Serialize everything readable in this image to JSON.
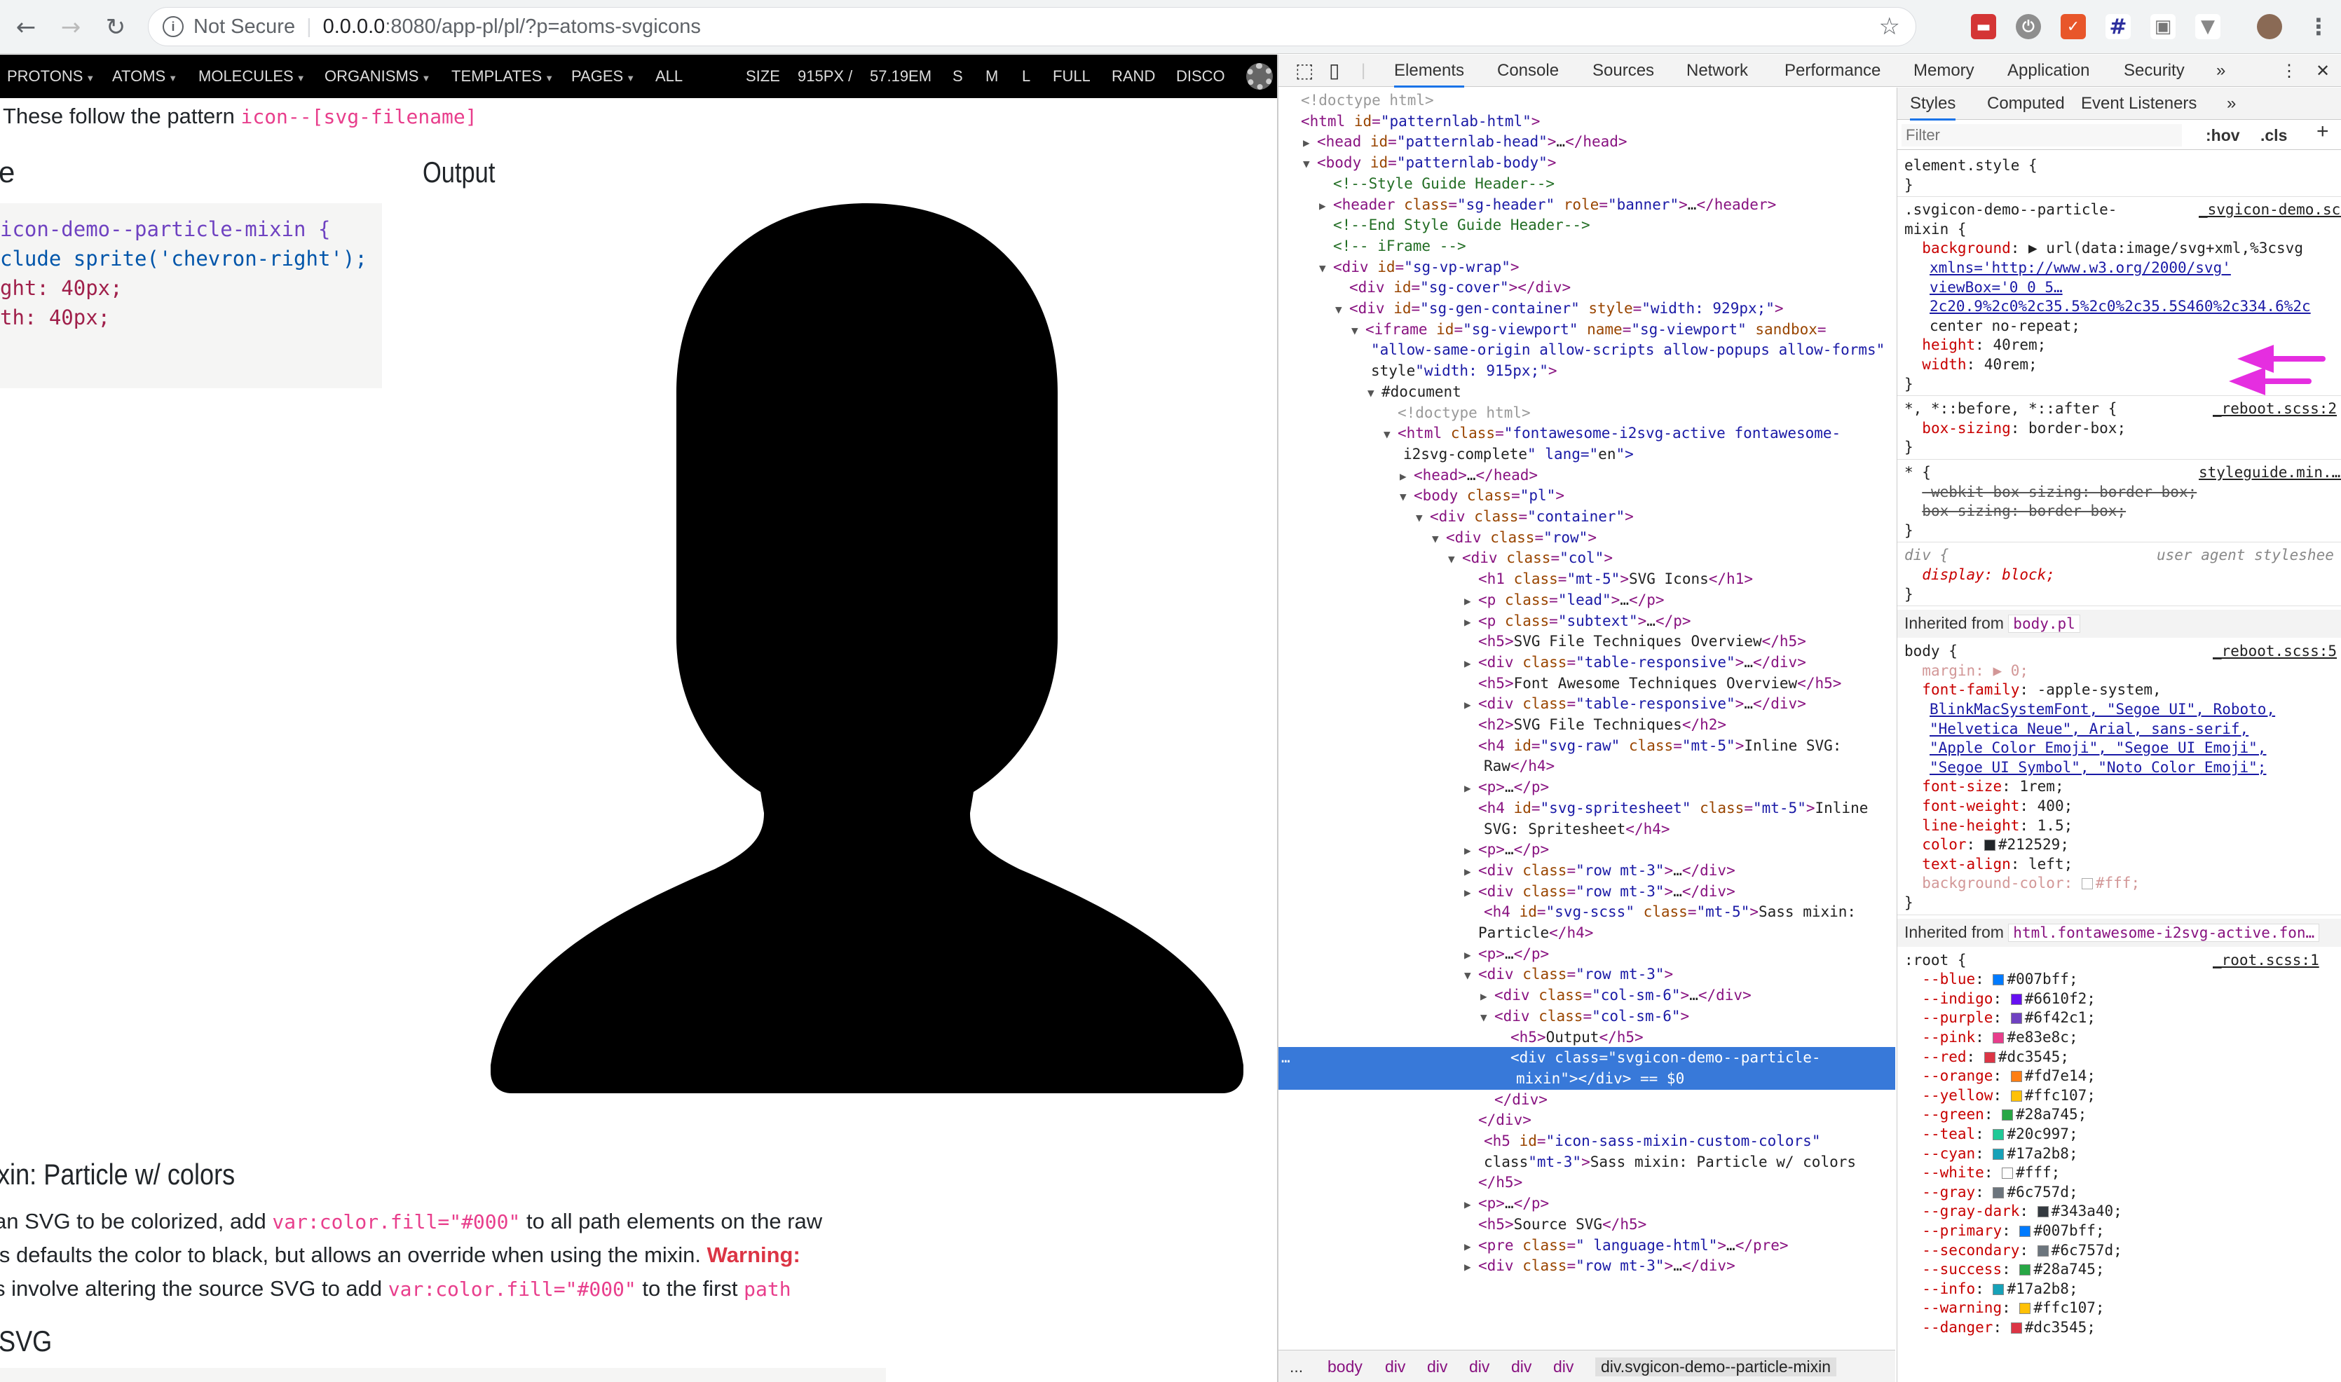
{
  "browser": {
    "security_label": "Not Secure",
    "url_host": "0.0.0.0",
    "url_path": ":8080/app-pl/pl/?p=atoms-svgicons"
  },
  "pl_nav": {
    "items": [
      {
        "label": "PROTONS"
      },
      {
        "label": "ATOMS"
      },
      {
        "label": "MOLECULES"
      },
      {
        "label": "ORGANISMS"
      },
      {
        "label": "TEMPLATES"
      },
      {
        "label": "PAGES"
      }
    ],
    "all_label": "ALL",
    "size_label": "SIZE",
    "size_px": "915PX /",
    "size_em": "57.19EM",
    "s": "S",
    "m": "M",
    "l": "L",
    "full": "FULL",
    "rand": "RAND",
    "disco": "DISCO"
  },
  "page": {
    "pattern_text": "These follow the pattern ",
    "pattern_code": "icon--[svg-filename]",
    "left_heading": "e",
    "output_heading": "Output",
    "code_lines": [
      "icon-demo--particle-mixin {",
      "clude sprite('chevron-right');",
      "ght: 40px;",
      "th: 40px;"
    ],
    "section_heading": "xin: Particle w/ colors",
    "p1a": " an SVG to be colorized, add ",
    "p1code": "var:color.fill=\"#000\"",
    "p1b": " to all path elements on the raw",
    "p2a": "is defaults the color to black, but allows an override when using the mixin. ",
    "p2warn": "Warning:",
    "p3a": "s involve altering the source SVG to add ",
    "p3code": "var:color.fill=\"#000\"",
    "p3b": " to the first ",
    "p3code2": "path",
    "p4": ".",
    "svg_heading": "SVG"
  },
  "devtools": {
    "tabs": [
      "Elements",
      "Console",
      "Sources",
      "Network",
      "Performance",
      "Memory",
      "Application",
      "Security"
    ],
    "more": "»",
    "breadcrumbs": [
      "...",
      "body",
      "div",
      "div",
      "div",
      "div",
      "div",
      "div.svgicon-demo--particle-mixin"
    ],
    "styles_tabs": [
      "Styles",
      "Computed",
      "Event Listeners",
      "»"
    ],
    "filter_placeholder": "Filter",
    "hov": ":hov",
    "cls": ".cls",
    "plus": "+",
    "inherited_body_label": "Inherited from ",
    "inherited_body_tag": "body.pl",
    "inherited_html_label": "Inherited from ",
    "inherited_html_tag": "html.fontawesome-i2svg-active.fon…"
  },
  "dom": [
    {
      "i": 0,
      "h": "<!doctype html>"
    },
    {
      "i": 0,
      "h": "<html id=\"patternlab-html\">"
    },
    {
      "i": 1,
      "h": "▶<head id=\"patternlab-head\">…</head>"
    },
    {
      "i": 1,
      "h": "▼<body id=\"patternlab-body\">"
    },
    {
      "i": 2,
      "h": "<!--Style Guide Header-->"
    },
    {
      "i": 2,
      "h": "▶<header class=\"sg-header\" role=\"banner\">…</header>"
    },
    {
      "i": 2,
      "h": "<!--End Style Guide Header-->"
    },
    {
      "i": 2,
      "h": "<!-- iFrame -->"
    },
    {
      "i": 2,
      "h": "▼<div id=\"sg-vp-wrap\">"
    },
    {
      "i": 3,
      "h": "<div id=\"sg-cover\"></div>"
    },
    {
      "i": 3,
      "h": "▼<div id=\"sg-gen-container\" style=\"width: 929px;\">"
    },
    {
      "i": 4,
      "h": "▼<iframe id=\"sg-viewport\" name=\"sg-viewport\" sandbox="
    },
    {
      "i": 4,
      "h": "\"allow-same-origin allow-scripts allow-popups allow-forms\""
    },
    {
      "i": 4,
      "h": "style=\"width: 915px;\">"
    },
    {
      "i": 5,
      "h": "▼#document"
    },
    {
      "i": 6,
      "h": "<!doctype html>"
    },
    {
      "i": 6,
      "h": "▼<html class=\"fontawesome-i2svg-active fontawesome-"
    },
    {
      "i": 6,
      "h": "i2svg-complete\" lang=\"en\">"
    },
    {
      "i": 7,
      "h": "▶<head>…</head>"
    },
    {
      "i": 7,
      "h": "▼<body class=\"pl\">"
    },
    {
      "i": 8,
      "h": "▼<div class=\"container\">"
    },
    {
      "i": 9,
      "h": "▼<div class=\"row\">"
    },
    {
      "i": 10,
      "h": "▼<div class=\"col\">"
    },
    {
      "i": 11,
      "h": "<h1 class=\"mt-5\">SVG Icons</h1>"
    },
    {
      "i": 11,
      "h": "▶<p class=\"lead\">…</p>"
    },
    {
      "i": 11,
      "h": "▶<p class=\"subtext\">…</p>"
    },
    {
      "i": 11,
      "h": "<h5>SVG File Techniques Overview</h5>"
    },
    {
      "i": 11,
      "h": "▶<div class=\"table-responsive\">…</div>"
    },
    {
      "i": 11,
      "h": "<h5>Font Awesome Techniques Overview</h5>"
    },
    {
      "i": 11,
      "h": "▶<div class=\"table-responsive\">…</div>"
    },
    {
      "i": 11,
      "h": "<h2>SVG File Techniques</h2>"
    },
    {
      "i": 11,
      "h": "<h4 id=\"svg-raw\" class=\"mt-5\">Inline SVG:"
    },
    {
      "i": 11,
      "h": "Raw</h4>"
    },
    {
      "i": 11,
      "h": "▶<p>…</p>"
    },
    {
      "i": 11,
      "h": "<h4 id=\"svg-spritesheet\" class=\"mt-5\">Inline"
    },
    {
      "i": 11,
      "h": "SVG: Spritesheet</h4>"
    },
    {
      "i": 11,
      "h": "▶<p>…</p>"
    },
    {
      "i": 11,
      "h": "▶<div class=\"row mt-3\">…</div>"
    },
    {
      "i": 11,
      "h": "▶<div class=\"row mt-3\">…</div>"
    },
    {
      "i": 11,
      "h": "<h4 id=\"svg-scss\" class=\"mt-5\">Sass mixin:"
    },
    {
      "i": 11,
      "h": "Particle</h4>"
    },
    {
      "i": 11,
      "h": "▶<p>…</p>"
    },
    {
      "i": 11,
      "h": "▼<div class=\"row mt-3\">"
    },
    {
      "i": 12,
      "h": "▶<div class=\"col-sm-6\">…</div>"
    },
    {
      "i": 12,
      "h": "▼<div class=\"col-sm-6\">"
    },
    {
      "i": 13,
      "h": "<h5>Output</h5>"
    },
    {
      "i": 13,
      "h": "<div class=\"svgicon-demo--particle-"
    },
    {
      "i": 13,
      "h": "mixin\"></div> == $0"
    },
    {
      "i": 12,
      "h": "</div>"
    },
    {
      "i": 11,
      "h": "</div>"
    },
    {
      "i": 11,
      "h": "<h5 id=\"icon-sass-mixin-custom-colors\""
    },
    {
      "i": 11,
      "h": "class=\"mt-3\">Sass mixin: Particle w/ colors"
    },
    {
      "i": 11,
      "h": "</h5>"
    },
    {
      "i": 11,
      "h": "▶<p>…</p>"
    },
    {
      "i": 11,
      "h": "<h5>Source SVG</h5>"
    },
    {
      "i": 11,
      "h": "▶<pre class=\" language-html\">…</pre>"
    },
    {
      "i": 11,
      "h": "▶<div class=\"row mt-3\">…</div>"
    }
  ],
  "css": [
    {
      "t": "sel",
      "s": "element.style {"
    },
    {
      "t": "end",
      "s": "}"
    },
    {
      "t": "sel2",
      "s": ".svgicon-demo--particle-",
      "src": "_svgicon-demo.scss:6"
    },
    {
      "t": "sel",
      "s": "mixin {"
    },
    {
      "t": "prop",
      "n": "background",
      "v": ": ▶ url(data:image/svg+xml,%3csvg"
    },
    {
      "t": "cont",
      "s": "xmlns='http://www.w3.org/2000/svg'"
    },
    {
      "t": "cont",
      "s": "viewBox='0 0 5…"
    },
    {
      "t": "cont",
      "s": "2c20.9%2c0%2c35.5%2c0%2c35.5S460%2c334.6%2c"
    },
    {
      "t": "cont2",
      "s": "center no-repeat;"
    },
    {
      "t": "prop",
      "n": "height",
      "v": ": 40rem;"
    },
    {
      "t": "prop",
      "n": "width",
      "v": ": 40rem;"
    },
    {
      "t": "end",
      "s": "}"
    },
    {
      "t": "sel2",
      "s": "*, *::before, *::after {",
      "src": "_reboot.scss:2"
    },
    {
      "t": "prop",
      "n": "box-sizing",
      "v": ": border-box;"
    },
    {
      "t": "end",
      "s": "}"
    },
    {
      "t": "sel2",
      "s": "* {",
      "src": "styleguide.min.…s?1542129977:"
    },
    {
      "t": "strike",
      "s": "-webkit-box-sizing: border-box;"
    },
    {
      "t": "strike",
      "s": "box-sizing: border-box;"
    },
    {
      "t": "end",
      "s": "}"
    },
    {
      "t": "ua",
      "s": "div {",
      "src": "user agent styleshee"
    },
    {
      "t": "uaprop",
      "s": "display: block;"
    },
    {
      "t": "end",
      "s": "}"
    }
  ],
  "body_css": [
    {
      "t": "sel2",
      "s": "body {",
      "src": "_reboot.scss:5"
    },
    {
      "t": "dim",
      "s": "margin: ▶ 0;"
    },
    {
      "t": "prop",
      "n": "font-family",
      "v": ": -apple-system,"
    },
    {
      "t": "cont",
      "s": "BlinkMacSystemFont, \"Segoe UI\", Roboto,"
    },
    {
      "t": "cont",
      "s": "\"Helvetica Neue\", Arial, sans-serif,"
    },
    {
      "t": "cont",
      "s": "\"Apple Color Emoji\", \"Segoe UI Emoji\","
    },
    {
      "t": "cont",
      "s": "\"Segoe UI Symbol\", \"Noto Color Emoji\";"
    },
    {
      "t": "prop",
      "n": "font-size",
      "v": ": 1rem;"
    },
    {
      "t": "prop",
      "n": "font-weight",
      "v": ": 400;"
    },
    {
      "t": "prop",
      "n": "line-height",
      "v": ": 1.5;"
    },
    {
      "t": "propc",
      "n": "color",
      "v": "#212529;",
      "c": "#212529"
    },
    {
      "t": "prop",
      "n": "text-align",
      "v": ": left;"
    },
    {
      "t": "dimc",
      "n": "background-color",
      "v": "#fff;",
      "c": "#ffffff"
    },
    {
      "t": "end",
      "s": "}"
    }
  ],
  "root_css": [
    {
      "n": "--blue",
      "v": "#007bff;",
      "c": "#007bff"
    },
    {
      "n": "--indigo",
      "v": "#6610f2;",
      "c": "#6610f2"
    },
    {
      "n": "--purple",
      "v": "#6f42c1;",
      "c": "#6f42c1"
    },
    {
      "n": "--pink",
      "v": "#e83e8c;",
      "c": "#e83e8c"
    },
    {
      "n": "--red",
      "v": "#dc3545;",
      "c": "#dc3545"
    },
    {
      "n": "--orange",
      "v": "#fd7e14;",
      "c": "#fd7e14"
    },
    {
      "n": "--yellow",
      "v": "#ffc107;",
      "c": "#ffc107"
    },
    {
      "n": "--green",
      "v": "#28a745;",
      "c": "#28a745"
    },
    {
      "n": "--teal",
      "v": "#20c997;",
      "c": "#20c997"
    },
    {
      "n": "--cyan",
      "v": "#17a2b8;",
      "c": "#17a2b8"
    },
    {
      "n": "--white",
      "v": "#fff;",
      "c": "#ffffff"
    },
    {
      "n": "--gray",
      "v": "#6c757d;",
      "c": "#6c757d"
    },
    {
      "n": "--gray-dark",
      "v": "#343a40;",
      "c": "#343a40"
    },
    {
      "n": "--primary",
      "v": "#007bff;",
      "c": "#007bff"
    },
    {
      "n": "--secondary",
      "v": "#6c757d;",
      "c": "#6c757d"
    },
    {
      "n": "--success",
      "v": "#28a745;",
      "c": "#28a745"
    },
    {
      "n": "--info",
      "v": "#17a2b8;",
      "c": "#17a2b8"
    },
    {
      "n": "--warning",
      "v": "#ffc107;",
      "c": "#ffc107"
    },
    {
      "n": "--danger",
      "v": "#dc3545;",
      "c": "#dc3545"
    }
  ],
  "root_sel": ":root {",
  "root_src": "_root.scss:1",
  "colors": {
    "annotation_arrow": "#e52ee0",
    "selection": "#3879d9",
    "pl_nav_bg": "#000000"
  }
}
